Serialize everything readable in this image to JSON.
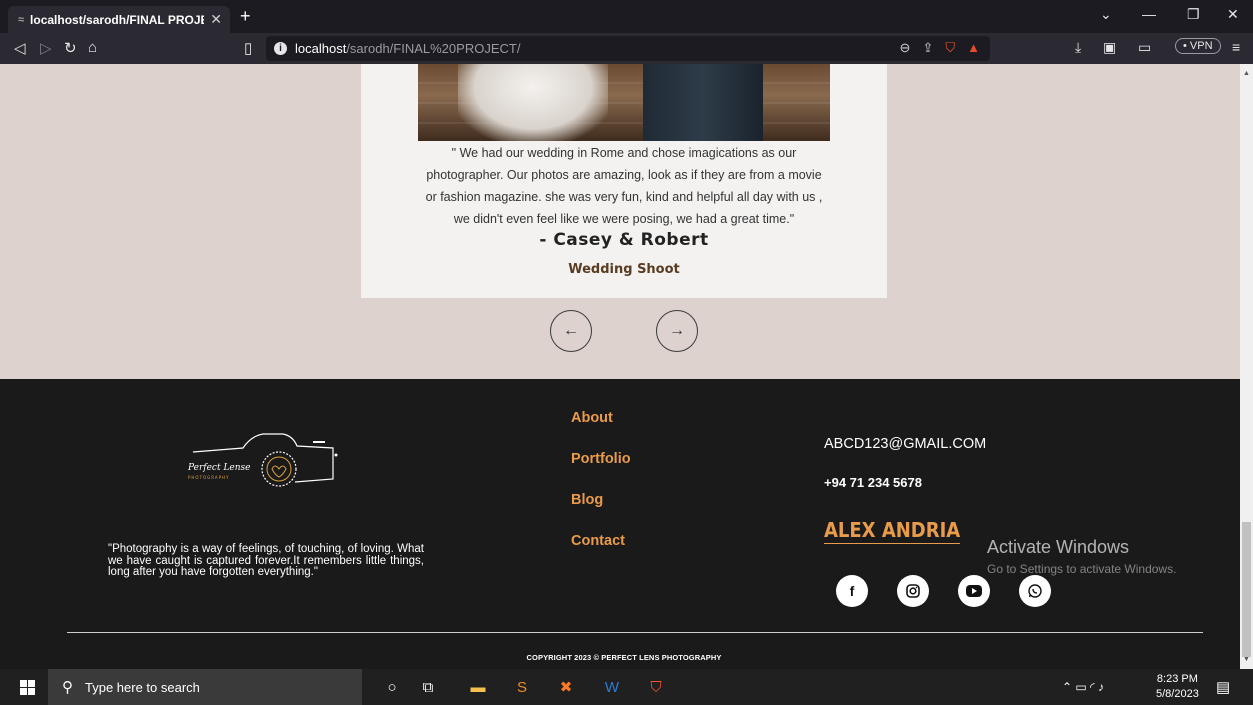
{
  "browser": {
    "tab_title": "localhost/sarodh/FINAL PROJECT/",
    "url_host": "localhost",
    "url_path": "/sarodh/FINAL%20PROJECT/",
    "vpn_label": "• VPN"
  },
  "testimonial": {
    "quote": "\" We had our wedding in Rome and chose imagications as our photographer. Our photos are amazing, look as if they are from a movie or fashion magazine. she was very fun, kind and helpful all day with us , we didn't even feel like we were posing, we had a great time.\"",
    "author": "- Casey & Robert",
    "shoot_type": "Wedding Shoot",
    "prev_icon": "arrow-left-icon",
    "next_icon": "arrow-right-icon"
  },
  "footer": {
    "logo_script": "Perfect Lense",
    "logo_sub": "PHOTOGRAPHY",
    "tagline": "\"Photography is a way of feelings, of touching, of loving. What we have caught is captured forever.It remembers little things, long after you have forgotten everything.\"",
    "links": [
      "About",
      "Portfolio",
      "Blog",
      "Contact"
    ],
    "email": "ABCD123@GMAIL.COM",
    "phone": "+94 71 234 5678",
    "name": "ALEX ANDRIA",
    "social_icons": [
      "facebook-icon",
      "instagram-icon",
      "youtube-icon",
      "whatsapp-icon"
    ],
    "copyright": "COPYRIGHT 2023 © PERFECT LENS PHOTOGRAPHY",
    "accent_color": "#e89b4a"
  },
  "watermark": {
    "line1": "Activate Windows",
    "line2": "Go to Settings to activate Windows."
  },
  "taskbar": {
    "search_placeholder": "Type here to search",
    "time": "8:23 PM",
    "date": "5/8/2023"
  }
}
